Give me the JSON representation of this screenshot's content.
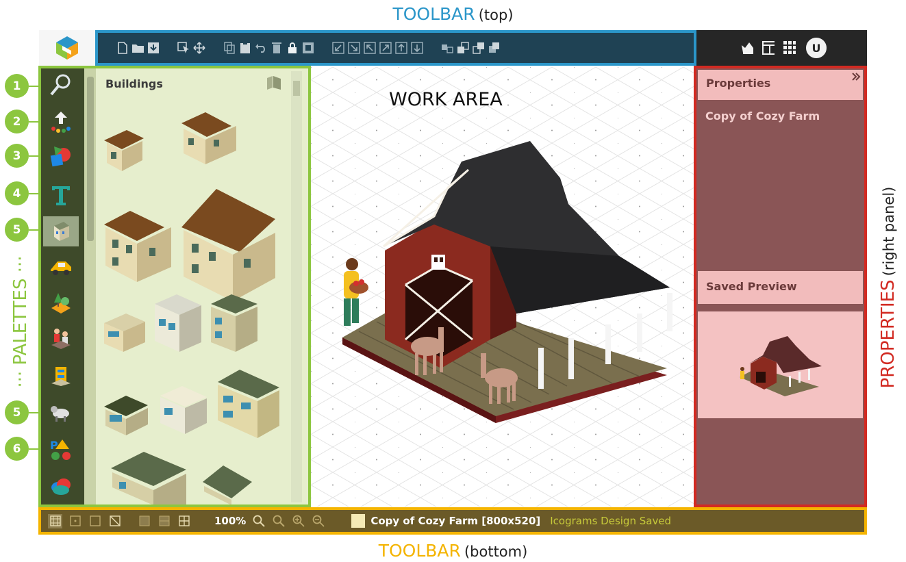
{
  "annotations": {
    "toolbar_top": "TOOLBAR",
    "toolbar_top_sub": "(top)",
    "toolbar_bottom": "TOOLBAR",
    "toolbar_bottom_sub": "(bottom)",
    "properties": "PROPERTIES",
    "properties_sub": "(right panel)",
    "palettes": "··· PALETTES ···",
    "work_area": "WORK AREA"
  },
  "palette_numbers": [
    "1",
    "2",
    "3",
    "4",
    "5",
    "5",
    "6"
  ],
  "palettes": {
    "icons": [
      "search-icon",
      "upload-icon",
      "shapes-icon",
      "text-icon",
      "buildings-icon",
      "vehicles-icon",
      "nature-icon",
      "people-icon",
      "objects-icon",
      "animals-icon",
      "symbols-icon",
      "clouds-icon"
    ],
    "active_index": 4
  },
  "buildings": {
    "title": "Buildings"
  },
  "properties": {
    "header": "Properties",
    "name": "Copy of Cozy Farm",
    "saved_preview": "Saved Preview"
  },
  "bottom": {
    "zoom": "100%",
    "file": "Copy of Cozy Farm [800x520]",
    "status": "Icograms Design Saved"
  },
  "user": {
    "initial": "U"
  },
  "colors": {
    "toolbar_top_accent": "#2b96c9",
    "toolbar_bottom_accent": "#f4b400",
    "properties_accent": "#d22a22",
    "palettes_accent": "#8cc63f"
  }
}
